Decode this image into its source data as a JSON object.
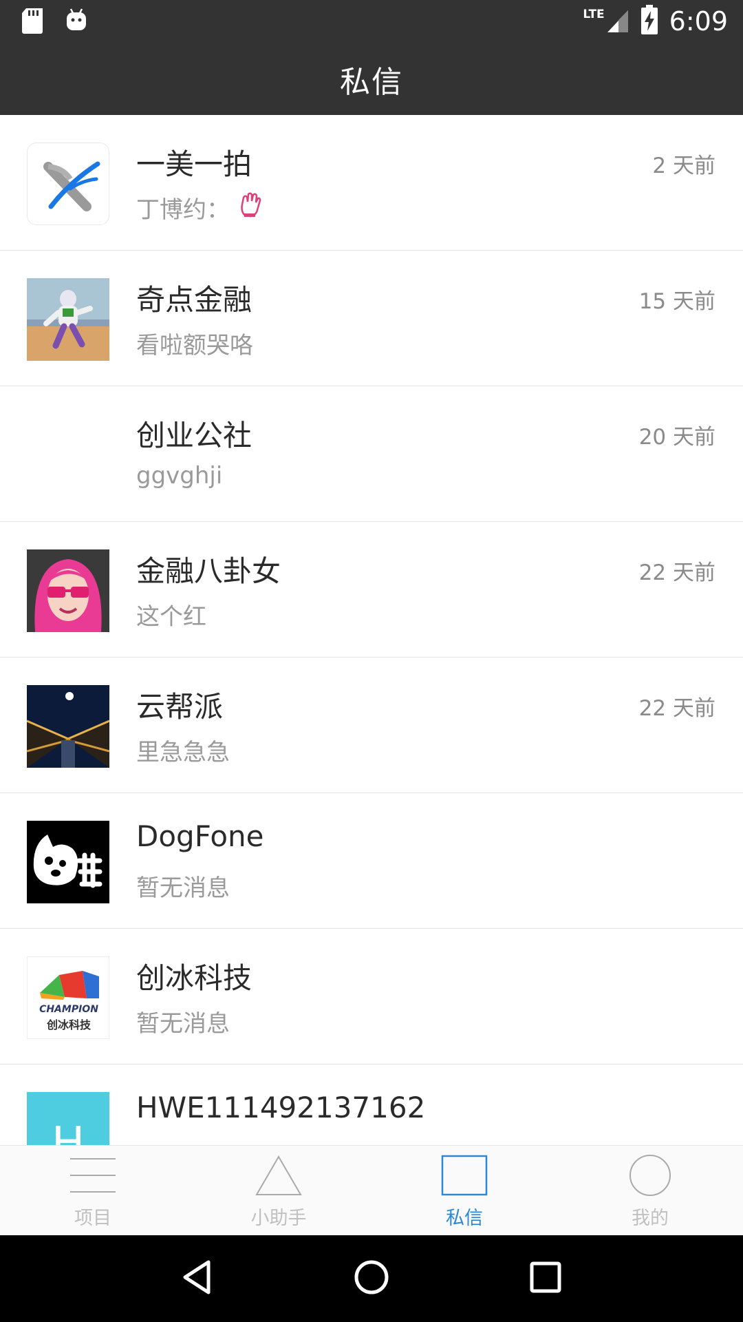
{
  "status_bar": {
    "time": "6:09",
    "network": "LTE",
    "left_icons": [
      "sd-card-icon",
      "android-icon"
    ]
  },
  "header": {
    "title": "私信"
  },
  "conversations": [
    {
      "name": "一美一拍",
      "preview": "丁博约：",
      "preview_icon": "clapping-hand-emoji-icon",
      "time": "2 天前",
      "avatar": "x-logo-avatar"
    },
    {
      "name": "奇点金融",
      "preview": "看啦额哭咯",
      "time": "15 天前",
      "avatar": "toy-figure-avatar"
    },
    {
      "name": "创业公社",
      "preview": "ggvghji",
      "time": "20 天前",
      "avatar": "blank-avatar"
    },
    {
      "name": "金融八卦女",
      "preview": "这个红",
      "time": "22 天前",
      "avatar": "pink-hair-girl-avatar"
    },
    {
      "name": "云帮派",
      "preview": "里急急急",
      "time": "22 天前",
      "avatar": "night-bridge-avatar"
    },
    {
      "name": "DogFone",
      "preview": "暂无消息",
      "time": "",
      "avatar": "dog-logo-avatar"
    },
    {
      "name": "创冰科技",
      "preview": "暂无消息",
      "time": "",
      "avatar": "champion-logo-avatar",
      "logo_text": "CHAMPION",
      "logo_subtext": "创冰科技"
    },
    {
      "name": "HWE111492137162",
      "preview": "",
      "time": "",
      "avatar": "letter-h-avatar",
      "avatar_letter": "H"
    }
  ],
  "tabs": [
    {
      "label": "项目",
      "icon": "menu-lines-icon",
      "active": false
    },
    {
      "label": "小助手",
      "icon": "triangle-icon",
      "active": false
    },
    {
      "label": "私信",
      "icon": "square-icon",
      "active": true
    },
    {
      "label": "我的",
      "icon": "circle-icon",
      "active": false
    }
  ],
  "colors": {
    "header_bg": "#333333",
    "accent": "#2b87d8",
    "tab_inactive": "#c0c0c0",
    "letter_avatar_bg": "#4ecde0"
  }
}
